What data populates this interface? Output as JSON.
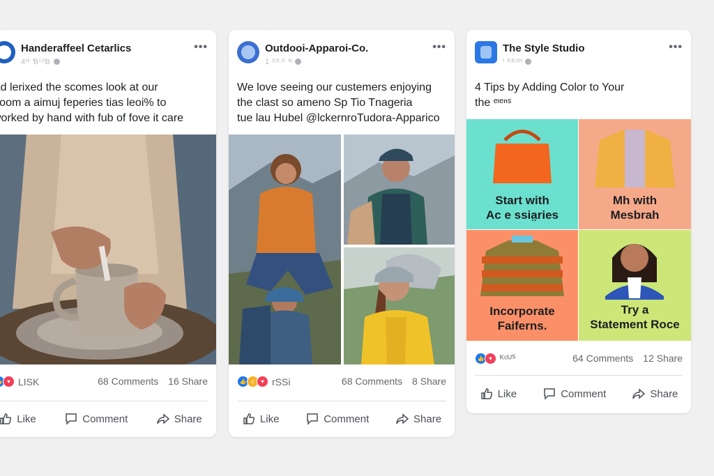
{
  "posts": [
    {
      "page_name": "Handeraffeel Cetarlics",
      "meta": "4ᴴ ƁᴵᴶƁ",
      "text_lines": [
        "Ad lerixed the scomes look at our",
        "ᵐoom a aimuj feperies tias leoi% to",
        "worked by hand with fub of fove it care"
      ],
      "reaction_label": "LISK",
      "comments": "68 Comments",
      "shares": "16 Share",
      "actions": {
        "like": "Like",
        "comment": "Comment",
        "share": "Share"
      }
    },
    {
      "page_name": "Outdooi-Apparoi-Co.",
      "meta": "1 ᴱᴷᴶᴵ ᴺ",
      "text_lines": [
        "We love seeing our custemers enjoying",
        "the clast so ameno Sp  Tio  Tnageria",
        "tue lau Hubel @lckernroTudora-Apparico"
      ],
      "reaction_label": "rSSi",
      "comments": "68 Comments",
      "shares": "8 Share",
      "actions": {
        "like": "Like",
        "comment": "Comment",
        "share": "Share"
      }
    },
    {
      "page_name": "The Style Studio",
      "meta": "ᴵ ᴷᴮᴶᴴ",
      "text_lines": [
        "4 Tips by Adding Color to Your",
        "the ᵉᶦᵉⁿˢ"
      ],
      "tiles": [
        {
          "caption": [
            "Start with",
            "Ac e ssia̤ries"
          ],
          "bg": "#6ce0cf"
        },
        {
          "caption": [
            "Mh with",
            "Mesbrah"
          ],
          "bg": "#f6a989"
        },
        {
          "caption": [
            "Incorporate",
            "Faiferns."
          ],
          "bg": "#fb9068"
        },
        {
          "caption": [
            "Try a",
            "Statement Roce"
          ],
          "bg": "#cde678"
        }
      ],
      "reaction_label": "ᴷᶜᵁᔆ",
      "comments": "64 Comments",
      "shares": "12 Share",
      "actions": {
        "like": "Like",
        "comment": "Comment",
        "share": "Share"
      }
    }
  ],
  "colors": {
    "accent": "#1877f2",
    "bg": "#f0f0f1",
    "card": "#ffffff"
  }
}
